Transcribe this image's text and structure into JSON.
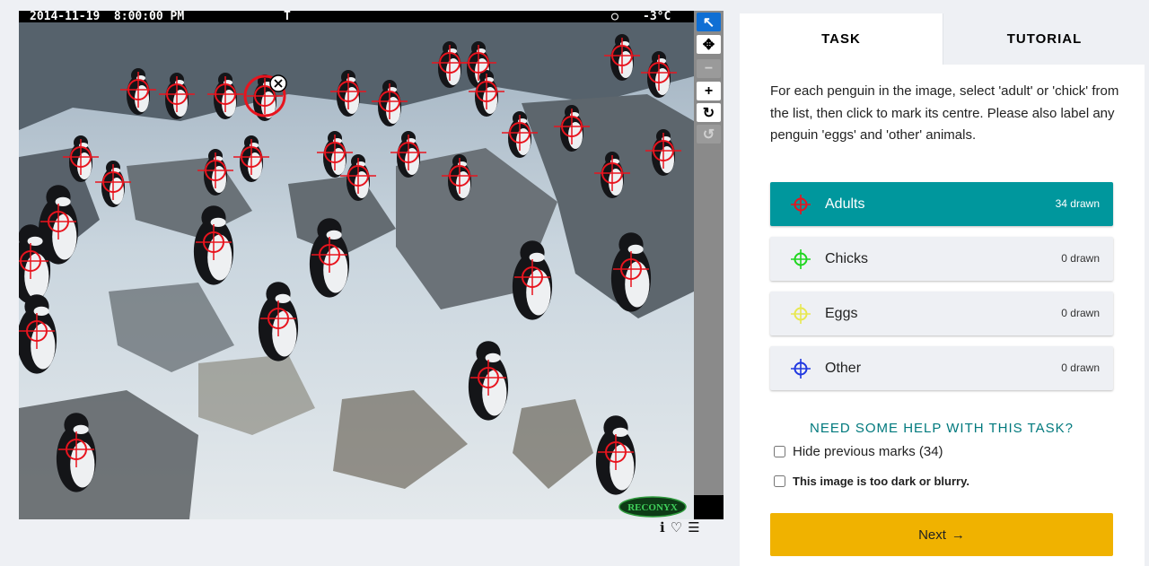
{
  "camera": {
    "timestamp": "2014-11-19  8:00:00 PM",
    "tag": "T",
    "moon": "○",
    "temperature": "-3°C",
    "brand": "RECONYX"
  },
  "viewer_tools": [
    {
      "name": "pointer-tool",
      "glyph": "↖",
      "state": "active"
    },
    {
      "name": "move-tool",
      "glyph": "✥",
      "state": "normal"
    },
    {
      "name": "zoom-out-tool",
      "glyph": "−",
      "state": "disabled"
    },
    {
      "name": "zoom-in-tool",
      "glyph": "+",
      "state": "normal"
    },
    {
      "name": "rotate-tool",
      "glyph": "↻",
      "state": "normal"
    },
    {
      "name": "reset-tool",
      "glyph": "↺",
      "state": "disabled"
    }
  ],
  "meta_icons": {
    "info": "ℹ",
    "favorite": "♡",
    "collections": "☰"
  },
  "tabs": {
    "task": "TASK",
    "tutorial": "TUTORIAL"
  },
  "instructions": "For each penguin in the image, select 'adult' or 'chick' from the list, then click to mark its centre. Please also label any penguin 'eggs' and 'other' animals.",
  "choices": [
    {
      "label": "Adults",
      "count": "34 drawn",
      "color": "#e8141e",
      "active": true
    },
    {
      "label": "Chicks",
      "count": "0 drawn",
      "color": "#1fd61f",
      "active": false
    },
    {
      "label": "Eggs",
      "count": "0 drawn",
      "color": "#e8e850",
      "active": false
    },
    {
      "label": "Other",
      "count": "0 drawn",
      "color": "#2038e0",
      "active": false
    }
  ],
  "help_text": "NEED SOME HELP WITH THIS TASK?",
  "hide_previous_label": "Hide previous marks (34)",
  "too_dark_label": "This image is too dark or blurry.",
  "next_label": "Next",
  "next_arrow": "→",
  "colors": {
    "accent": "#00979d",
    "next": "#f0b200",
    "mark": "#e8141e"
  }
}
